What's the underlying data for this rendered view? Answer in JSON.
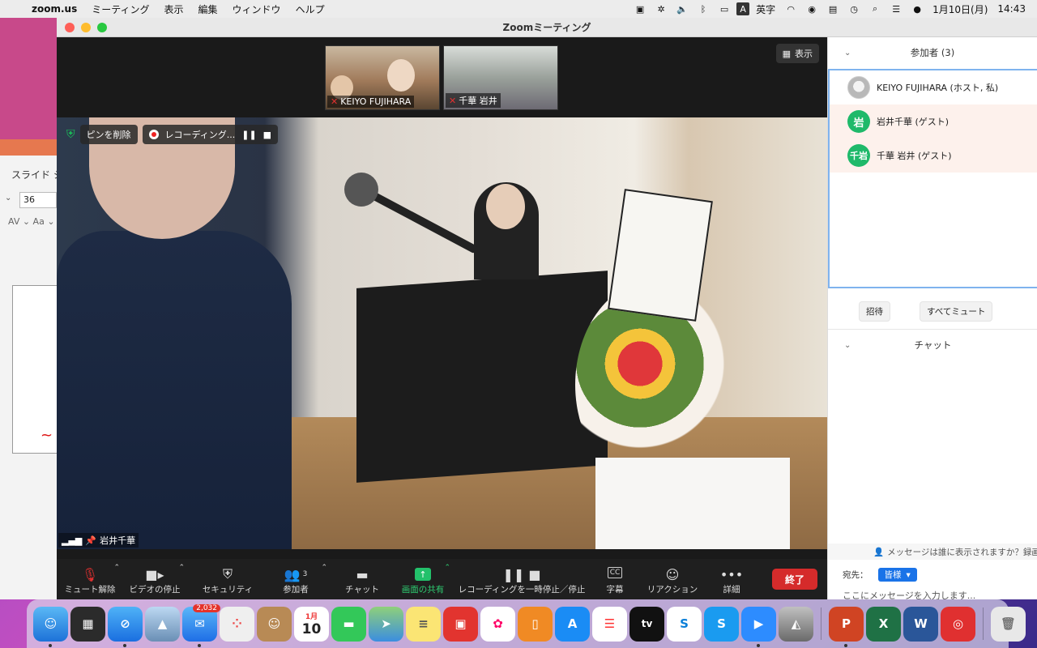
{
  "menubar": {
    "app": "zoom.us",
    "menus": [
      "ミーティング",
      "表示",
      "編集",
      "ウィンドウ",
      "ヘルプ"
    ],
    "input_mode": "A",
    "input_label": "英字",
    "datetime": "1月10日(月)",
    "time": "14:43"
  },
  "ppt": {
    "tab_label": "スライド シ",
    "font_size": "36",
    "tools": "AV ⌄  Aa ⌄"
  },
  "window": {
    "title": "Zoomミーティング"
  },
  "thumbnails": [
    {
      "name": "KEIYO FUJIHARA"
    },
    {
      "name": "千華 岩井"
    }
  ],
  "view_button": "表示",
  "pin": {
    "unpin_label": "ピンを削除",
    "recording_label": "レコーディング..."
  },
  "main_video": {
    "name": "岩井千華"
  },
  "toolbar": {
    "unmute": "ミュート解除",
    "stop_video": "ビデオの停止",
    "security": "セキュリティ",
    "participants": "参加者",
    "participants_count": "3",
    "chat": "チャット",
    "share": "画面の共有",
    "recording": "レコーディングを一時停止／停止",
    "captions": "字幕",
    "reactions": "リアクション",
    "more": "詳細",
    "end": "終了"
  },
  "panel": {
    "participants_header": "参加者 (3)",
    "participants": [
      {
        "name": "KEIYO FUJIHARA (ホスト, 私)",
        "avatar": ""
      },
      {
        "name": "岩井千華 (ゲスト)",
        "avatar": "岩"
      },
      {
        "name": "千華 岩井 (ゲスト)",
        "avatar": "千岩"
      }
    ],
    "invite": "招待",
    "mute_all": "すべてミュート",
    "chat_header": "チャット",
    "chat_info": "メッセージは誰に表示されますか？録画が",
    "to_label": "宛先：",
    "to_value": "皆様",
    "input_placeholder": "ここにメッセージを入力します..."
  },
  "dock": {
    "mail_badge": "2,032",
    "calendar_month": "1月",
    "calendar_day": "10"
  }
}
